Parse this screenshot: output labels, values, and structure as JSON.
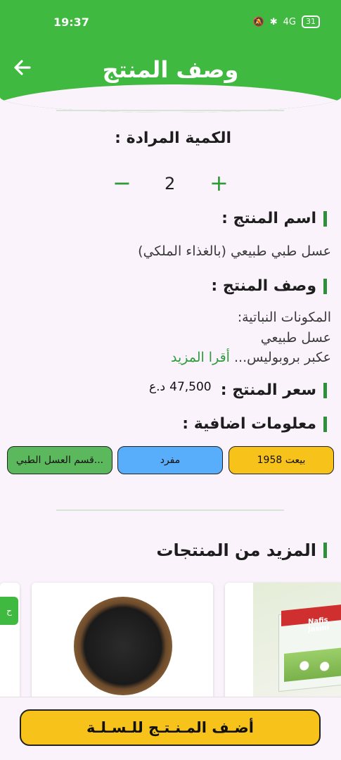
{
  "status": {
    "time": "19:37",
    "battery": "31",
    "signal": "4G"
  },
  "header": {
    "title": "وصف المنتج"
  },
  "quantity": {
    "label": "الكمية المرادة :",
    "value": "2",
    "minus": "−",
    "plus": "+"
  },
  "product_name": {
    "label": "اسم المنتج :",
    "value": "عسل طبي طبيعي (بالغذاء الملكي)"
  },
  "description": {
    "label": "وصف المنتج :",
    "line1": "المكونات النباتية:",
    "line2": "عسل طبيعي",
    "line3": "عكبر بروبوليس...",
    "read_more": "أقرا المزيد"
  },
  "price": {
    "label": "سعر المنتج :",
    "value": "47,500",
    "currency": "د.ع"
  },
  "extra": {
    "label": "معلومات اضافية :"
  },
  "chips": {
    "sold": "بيعت 1958",
    "single": "مفرد",
    "section": "قسم العسل الطبي..."
  },
  "more": {
    "title": "المزيد من المنتجات",
    "tab_text": "ح"
  },
  "product_box_brand": "Nafis Jasmi",
  "footer": {
    "add_label": "أضـف المـنـتـج للـسـلـة"
  },
  "colors": {
    "primary": "#3fb93f",
    "accent": "#f7c21a",
    "chip_blue": "#58aefa",
    "chip_green": "#5cb85c"
  }
}
